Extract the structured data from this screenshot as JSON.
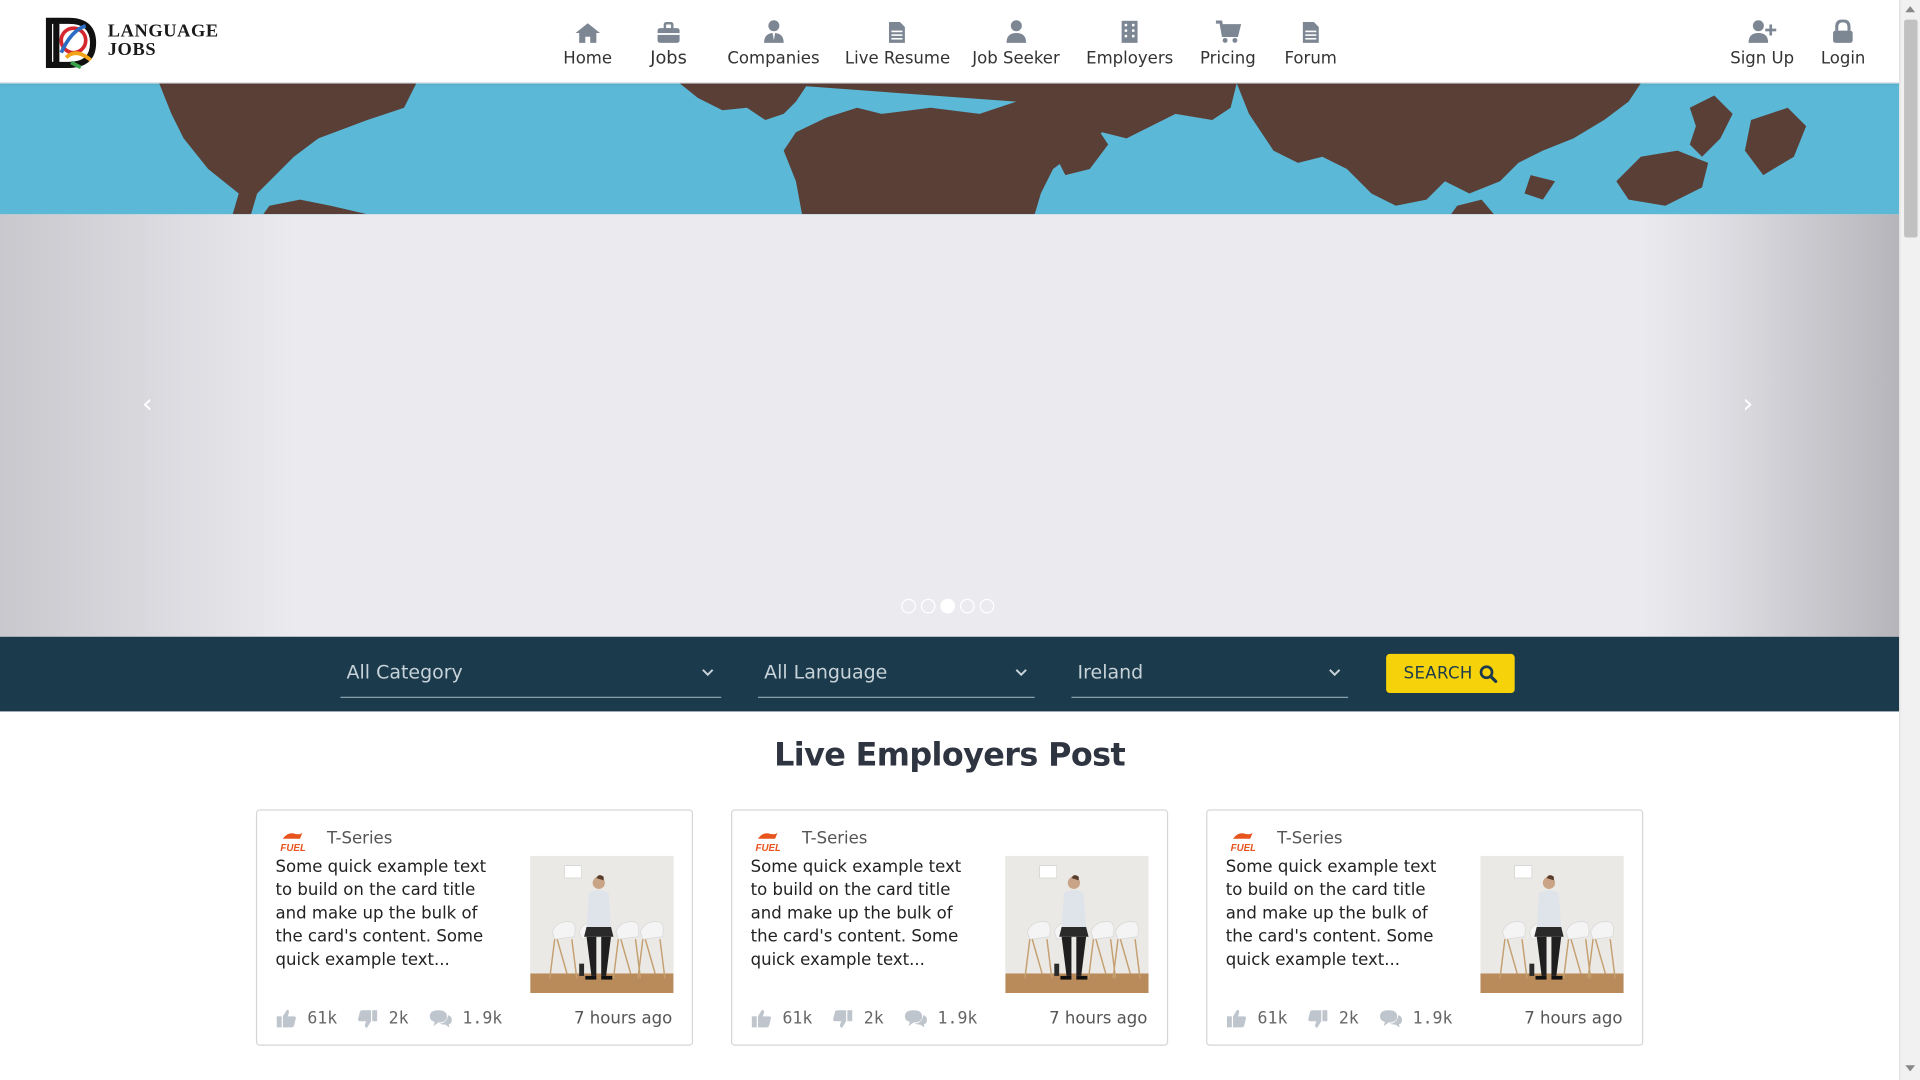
{
  "brand": {
    "line1": "LANGUAGE",
    "line2": "JOBS"
  },
  "nav": {
    "items": [
      {
        "label": "Home",
        "icon": "home-icon"
      },
      {
        "label": "Jobs",
        "icon": "briefcase-icon"
      },
      {
        "label": "Companies",
        "icon": "user-tie-icon"
      },
      {
        "label": "Live Resume",
        "icon": "document-icon"
      },
      {
        "label": "Job Seeker",
        "icon": "user-icon"
      },
      {
        "label": "Employers",
        "icon": "building-icon"
      },
      {
        "label": "Pricing",
        "icon": "cart-icon"
      },
      {
        "label": "Forum",
        "icon": "document-icon"
      }
    ],
    "signup": {
      "label": "Sign Up",
      "icon": "user-plus-icon"
    },
    "login": {
      "label": "Login",
      "icon": "lock-icon"
    }
  },
  "carousel": {
    "prev": "‹",
    "next": "›",
    "slide_count": 5,
    "active_index": 3
  },
  "search": {
    "category": "All Category",
    "language": "All Language",
    "location": "Ireland",
    "button_label": "SEARCH"
  },
  "section": {
    "title": "Live Employers Post"
  },
  "cards": [
    {
      "company": "T-Series",
      "logo_text": "FUEL",
      "description": "Some quick example text to build on the card title and make up the bulk of the card's content. Some quick example text...",
      "likes": "61k",
      "dislikes": "2k",
      "comments": "1.9k",
      "time": "7 hours ago"
    },
    {
      "company": "T-Series",
      "logo_text": "FUEL",
      "description": "Some quick example text to build on the card title and make up the bulk of the card's content. Some quick example text...",
      "likes": "61k",
      "dislikes": "2k",
      "comments": "1.9k",
      "time": "7 hours ago"
    },
    {
      "company": "T-Series",
      "logo_text": "FUEL",
      "description": "Some quick example text to build on the card title and make up the bulk of the card's content. Some quick example text...",
      "likes": "61k",
      "dislikes": "2k",
      "comments": "1.9k",
      "time": "7 hours ago"
    }
  ],
  "colors": {
    "nav_icon": "#7d8794",
    "search_bar_bg": "#1b3a4c",
    "search_button": "#f6d20a",
    "map_ocean": "#5bb8d6",
    "map_land": "#5a3f37"
  }
}
